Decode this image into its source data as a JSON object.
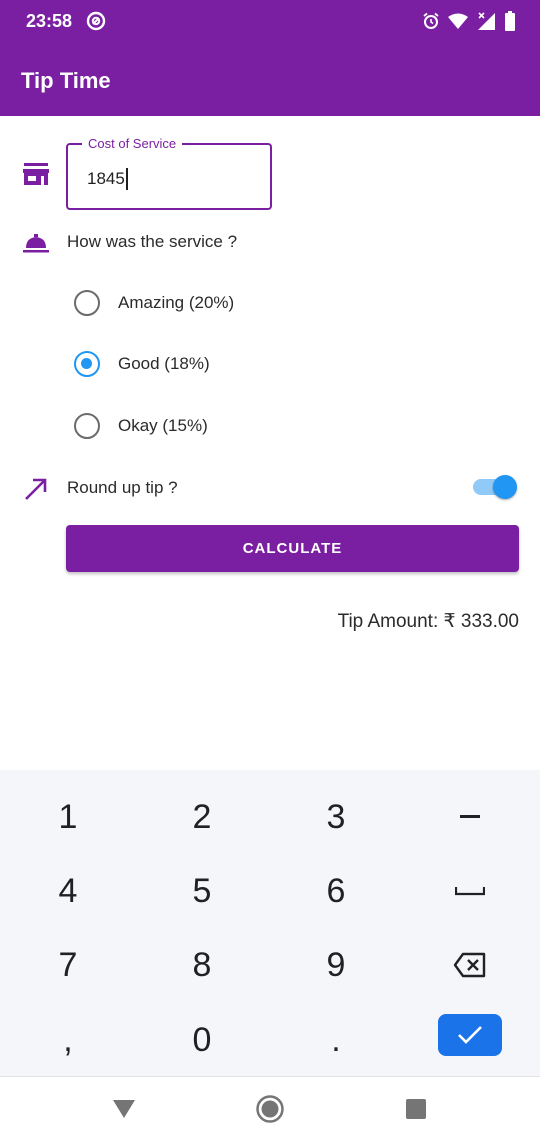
{
  "status_bar": {
    "time": "23:58"
  },
  "app_bar": {
    "title": "Tip Time"
  },
  "cost_field": {
    "label": "Cost of Service",
    "value": "1845"
  },
  "service_question": "How was the service ?",
  "options": [
    {
      "label": "Amazing (20%)",
      "selected": false
    },
    {
      "label": "Good (18%)",
      "selected": true
    },
    {
      "label": "Okay (15%)",
      "selected": false
    }
  ],
  "round_up": {
    "label": "Round up tip ?",
    "enabled": true
  },
  "calculate_label": "CALCULATE",
  "tip_amount": "Tip Amount: ₹ 333.00",
  "keyboard": {
    "keys": [
      "1",
      "2",
      "3",
      "-",
      "4",
      "5",
      "6",
      "␣",
      "7",
      "8",
      "9",
      "⌫",
      ",",
      "0",
      "."
    ]
  },
  "colors": {
    "primary": "#7B1FA2",
    "accent": "#2196F3",
    "keyboard_ok": "#1A73E8"
  }
}
